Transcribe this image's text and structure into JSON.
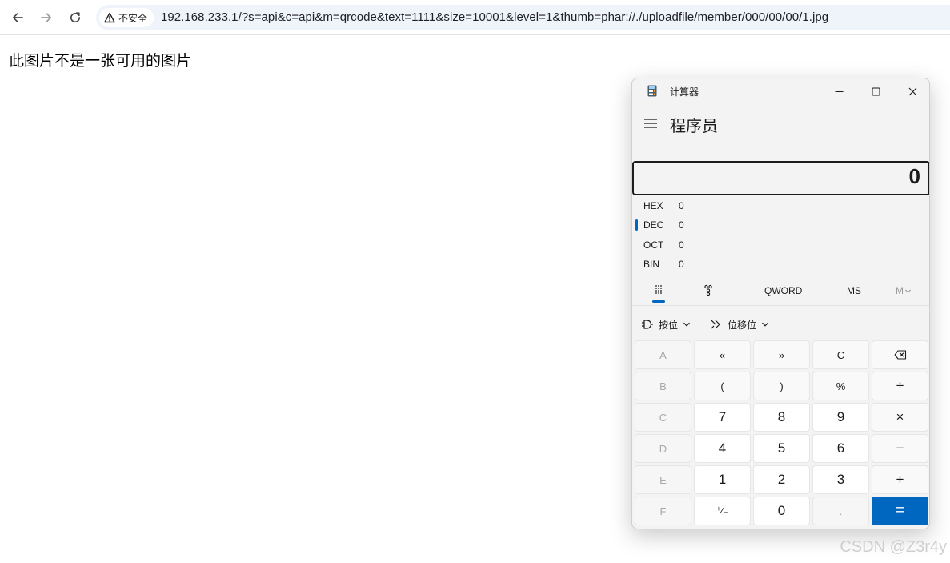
{
  "browser": {
    "security_label": "不安全",
    "url": "192.168.233.1/?s=api&c=api&m=qrcode&text=1111&size=10001&level=1&thumb=phar://./uploadfile/member/000/00/00/1.jpg",
    "icons": {
      "back": "arrow-left-icon",
      "forward": "arrow-right-icon",
      "reload": "reload-icon",
      "warning": "warning-triangle-icon"
    }
  },
  "page": {
    "message": "此图片不是一张可用的图片"
  },
  "calculator": {
    "window_title": "计算器",
    "mode": "程序员",
    "display_value": "0",
    "radix": [
      {
        "name": "HEX",
        "value": "0",
        "active": false
      },
      {
        "name": "DEC",
        "value": "0",
        "active": true
      },
      {
        "name": "OCT",
        "value": "0",
        "active": false
      },
      {
        "name": "BIN",
        "value": "0",
        "active": false
      }
    ],
    "word_size": "QWORD",
    "memory_store": "MS",
    "memory_list": "M",
    "bitwise_label": "按位",
    "bitshift_label": "位移位",
    "accent_color": "#0067c0",
    "keys": [
      [
        "A",
        "«",
        "»",
        "C",
        "⌫"
      ],
      [
        "B",
        "(",
        ")",
        "%",
        "÷"
      ],
      [
        "C",
        "7",
        "8",
        "9",
        "×"
      ],
      [
        "D",
        "4",
        "5",
        "6",
        "−"
      ],
      [
        "E",
        "1",
        "2",
        "3",
        "+"
      ],
      [
        "F",
        "⁺∕₋",
        "0",
        ".",
        "="
      ]
    ]
  },
  "watermark": "CSDN @Z3r4y"
}
